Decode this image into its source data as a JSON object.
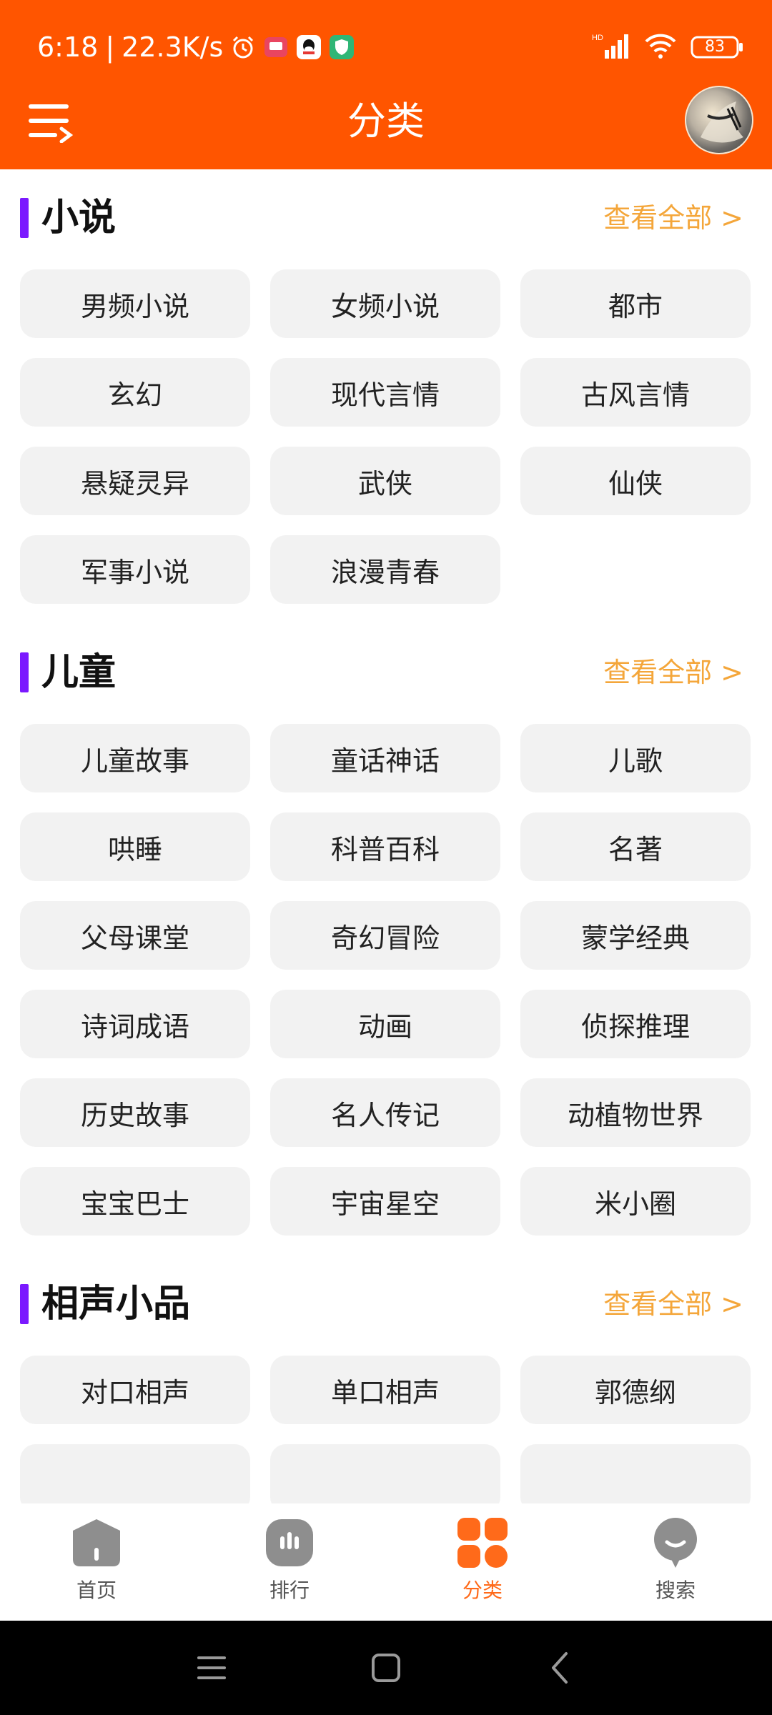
{
  "status_bar": {
    "time": "6:18",
    "net_speed": "22.3K/s",
    "battery": "83",
    "network_type": "HD"
  },
  "header": {
    "title": "分类"
  },
  "sections": [
    {
      "title": "小说",
      "view_all": "查看全部 >",
      "items": [
        "男频小说",
        "女频小说",
        "都市",
        "玄幻",
        "现代言情",
        "古风言情",
        "悬疑灵异",
        "武侠",
        "仙侠",
        "军事小说",
        "浪漫青春"
      ]
    },
    {
      "title": "儿童",
      "view_all": "查看全部 >",
      "items": [
        "儿童故事",
        "童话神话",
        "儿歌",
        "哄睡",
        "科普百科",
        "名著",
        "父母课堂",
        "奇幻冒险",
        "蒙学经典",
        "诗词成语",
        "动画",
        "侦探推理",
        "历史故事",
        "名人传记",
        "动植物世界",
        "宝宝巴士",
        "宇宙星空",
        "米小圈"
      ]
    },
    {
      "title": "相声小品",
      "view_all": "查看全部 >",
      "items": [
        "对口相声",
        "单口相声",
        "郭德纲"
      ]
    }
  ],
  "bottom_nav": [
    {
      "label": "首页",
      "icon": "home-icon",
      "active": false
    },
    {
      "label": "排行",
      "icon": "ranking-icon",
      "active": false
    },
    {
      "label": "分类",
      "icon": "category-icon",
      "active": true
    },
    {
      "label": "搜索",
      "icon": "search-icon",
      "active": false
    }
  ],
  "colors": {
    "header_bg": "#FF5500",
    "accent_bar": "#7B19FF",
    "view_all": "#F4A63A",
    "chip_bg": "#F2F2F2",
    "nav_active": "#FF6A1A",
    "nav_inactive": "#8E8E8E"
  }
}
